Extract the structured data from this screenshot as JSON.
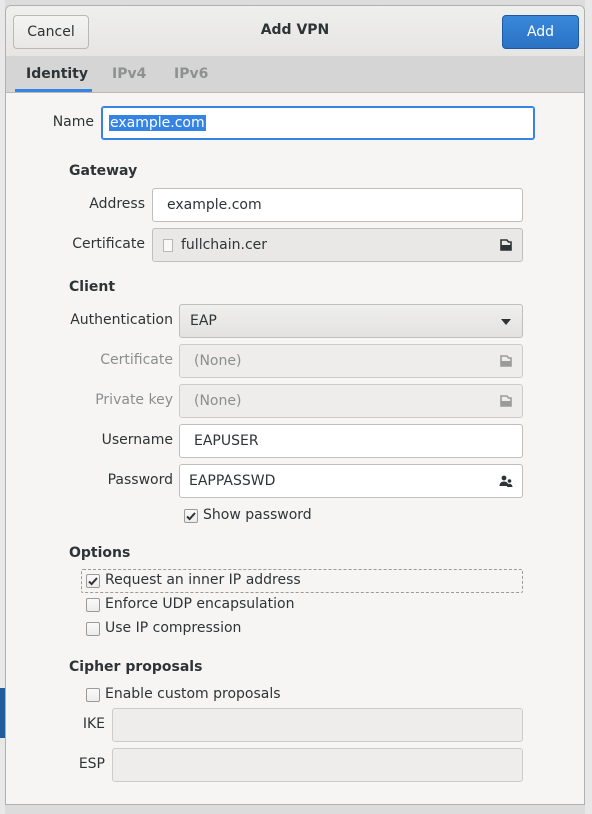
{
  "header": {
    "title": "Add VPN",
    "cancel_label": "Cancel",
    "add_label": "Add"
  },
  "tabs": [
    {
      "label": "Identity",
      "active": true
    },
    {
      "label": "IPv4",
      "active": false
    },
    {
      "label": "IPv6",
      "active": false
    }
  ],
  "name": {
    "label": "Name",
    "value": "example.com"
  },
  "gateway": {
    "title": "Gateway",
    "address_label": "Address",
    "address_value": "example.com",
    "certificate_label": "Certificate",
    "certificate_value": "fullchain.cer"
  },
  "client": {
    "title": "Client",
    "authentication_label": "Authentication",
    "authentication_value": "EAP",
    "certificate_label": "Certificate",
    "certificate_value": "(None)",
    "private_key_label": "Private key",
    "private_key_value": "(None)",
    "username_label": "Username",
    "username_value": "EAPUSER",
    "password_label": "Password",
    "password_value": "EAPPASSWD",
    "show_password_label": "Show password",
    "show_password_checked": true
  },
  "options": {
    "title": "Options",
    "items": [
      {
        "label": "Request an inner IP address",
        "checked": true
      },
      {
        "label": "Enforce UDP encapsulation",
        "checked": false
      },
      {
        "label": "Use IP compression",
        "checked": false
      }
    ]
  },
  "cipher": {
    "title": "Cipher proposals",
    "enable_label": "Enable custom proposals",
    "enable_checked": false,
    "ike_label": "IKE",
    "ike_value": "",
    "esp_label": "ESP",
    "esp_value": ""
  },
  "colors": {
    "accent": "#3584e4",
    "header_bg": "#e9e8e6",
    "dialog_bg": "#f6f5f4"
  },
  "icons": [
    "document-icon",
    "file-open-icon",
    "password-user-icon",
    "check-icon",
    "dropdown-arrow-icon"
  ]
}
